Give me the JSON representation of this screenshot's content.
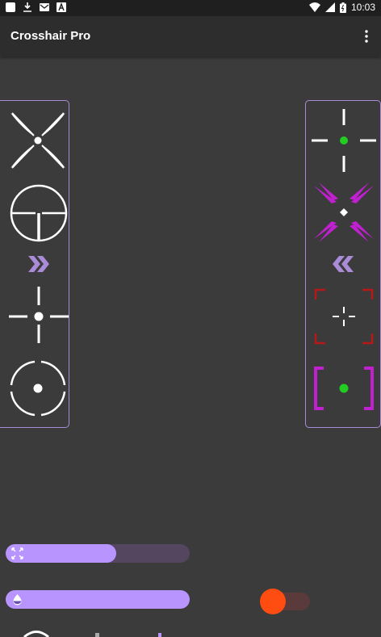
{
  "status_bar": {
    "time": "10:03",
    "battery_label": "100%",
    "left_icons": [
      "app-notification-icon",
      "download-icon",
      "mail-icon",
      "text-icon"
    ],
    "right_icons": [
      "wifi-icon",
      "signal-icon",
      "battery-icon"
    ]
  },
  "app_bar": {
    "title": "Crosshair Pro",
    "menu_icon": "more-vert-icon"
  },
  "left_panel": {
    "items": [
      "x-crosshair-icon",
      "scope-crosshair-icon",
      "chevron-double-right-icon",
      "dot-gap-crosshair-icon",
      "circle-dot-crosshair-icon"
    ]
  },
  "right_panel": {
    "items": [
      "green-dot-crosshair-icon",
      "magenta-diamond-crosshair-icon",
      "chevron-double-left-icon",
      "red-corners-crosshair-icon",
      "magenta-brackets-crosshair-icon"
    ]
  },
  "controls": {
    "size_slider": {
      "icon": "expand-arrows-icon",
      "value_fraction": 0.6
    },
    "opacity_slider": {
      "icon": "opacity-drop-icon",
      "value_fraction": 1.0
    },
    "toggle": {
      "on": true,
      "color": "#ff4c10"
    }
  },
  "colors": {
    "accent": "#b894ff",
    "panel_border": "#a98bd8",
    "green_dot": "#22cc22",
    "magenta": "#c020d0",
    "red": "#b81818"
  }
}
